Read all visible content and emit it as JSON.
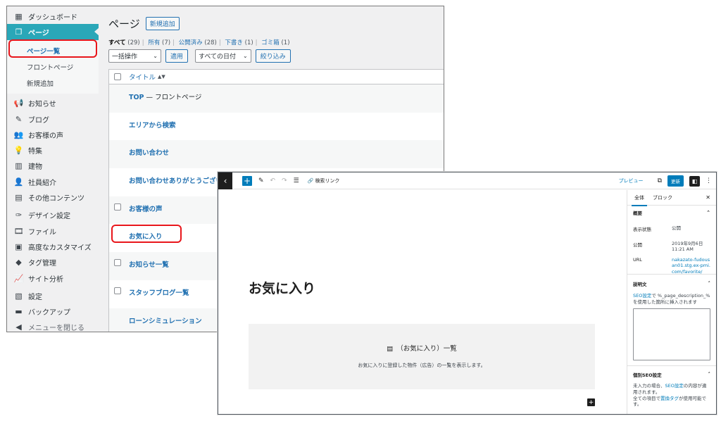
{
  "admin": {
    "sidebar": {
      "items": [
        {
          "label": "ダッシュボード",
          "icon": "dashboard-icon",
          "glyph": "▦"
        },
        {
          "label": "ページ",
          "icon": "pages-icon",
          "glyph": "❐"
        },
        {
          "label": "お知らせ",
          "icon": "megaphone-icon",
          "glyph": "📢"
        },
        {
          "label": "ブログ",
          "icon": "pencil-icon",
          "glyph": "✎"
        },
        {
          "label": "お客様の声",
          "icon": "groups-icon",
          "glyph": "👥"
        },
        {
          "label": "特集",
          "icon": "lightbulb-icon",
          "glyph": "💡"
        },
        {
          "label": "建物",
          "icon": "building-icon",
          "glyph": "▥"
        },
        {
          "label": "社員紹介",
          "icon": "businessman-icon",
          "glyph": "👤"
        },
        {
          "label": "その他コンテンツ",
          "icon": "document-icon",
          "glyph": "▤"
        },
        {
          "label": "デザイン設定",
          "icon": "appearance-brush-icon",
          "glyph": "✑"
        },
        {
          "label": "ファイル",
          "icon": "media-icon",
          "glyph": "🎞"
        },
        {
          "label": "高度なカスタマイズ",
          "icon": "code-icon",
          "glyph": "▣"
        },
        {
          "label": "タグ管理",
          "icon": "tag-icon",
          "glyph": "◆"
        },
        {
          "label": "サイト分析",
          "icon": "chart-icon",
          "glyph": "📈"
        },
        {
          "label": "設定",
          "icon": "settings-icon",
          "glyph": "▧"
        },
        {
          "label": "バックアップ",
          "icon": "archive-icon",
          "glyph": "▬"
        },
        {
          "label": "メニューを閉じる",
          "icon": "collapse-icon",
          "glyph": "◀"
        }
      ],
      "sub_items": [
        "ページ一覧",
        "フロントページ",
        "新規追加"
      ]
    },
    "main": {
      "title": "ページ",
      "add_new": "新規追加",
      "views": {
        "all": "すべて",
        "all_count": "(29)",
        "mine": "所有",
        "mine_count": "(7)",
        "published": "公開済み",
        "published_count": "(28)",
        "drafts": "下書き",
        "drafts_count": "(1)",
        "trash": "ゴミ箱",
        "trash_count": "(1)"
      },
      "bulk_action": "一括操作",
      "apply": "適用",
      "date_filter": "すべての日付",
      "filter": "絞り込み",
      "column_title": "タイトル",
      "rows": [
        {
          "title": "TOP",
          "state": " — フロントページ"
        },
        {
          "title": "エリアから検索",
          "state": ""
        },
        {
          "title": "お問い合わせ",
          "state": ""
        },
        {
          "title": "お問い合わせありがとうござい",
          "state": ""
        },
        {
          "title": "お客様の声",
          "state": ""
        },
        {
          "title": "お気に入り",
          "state": ""
        },
        {
          "title": "お知らせ一覧",
          "state": ""
        },
        {
          "title": "スタッフブログ一覧",
          "state": ""
        },
        {
          "title": "ローンシミュレーション",
          "state": ""
        }
      ]
    }
  },
  "editor": {
    "toolbar": {
      "seo_link": "検索リンク",
      "preview": "プレビュー",
      "update": "更新"
    },
    "heading": "お気に入り",
    "block": {
      "title": "（お気に入り）一覧",
      "description": "お気に入りに登録した物件（広告）の一覧を表示します。"
    },
    "sidebar": {
      "tab_document": "全体",
      "tab_block": "ブロック",
      "summary_title": "概要",
      "visibility_label": "表示状態",
      "visibility_value": "公開",
      "publish_label": "公開",
      "publish_value": "2019年9月6日 11:21 AM",
      "url_label": "URL",
      "url_value": "nakazato-fudousan01.stg.ex-pmi.com/favorite/",
      "description_title": "説明文",
      "description_link": "SEO設定",
      "description_text": "で %_page_description_% を使用した箇所に挿入されます",
      "seo_title": "個別SEO設定",
      "seo_text_1": "未入力の場合、",
      "seo_link": "SEO設定",
      "seo_text_2": "の内容が適用されます。",
      "seo_text_3": "全ての項目で",
      "seo_link_2": "置換タグ",
      "seo_text_4": "が使用可能です。"
    }
  },
  "colors": {
    "highlight": "#e8161b",
    "admin_accent": "#2aa7b8",
    "link": "#2271b1",
    "editor_blue": "#007cba"
  }
}
